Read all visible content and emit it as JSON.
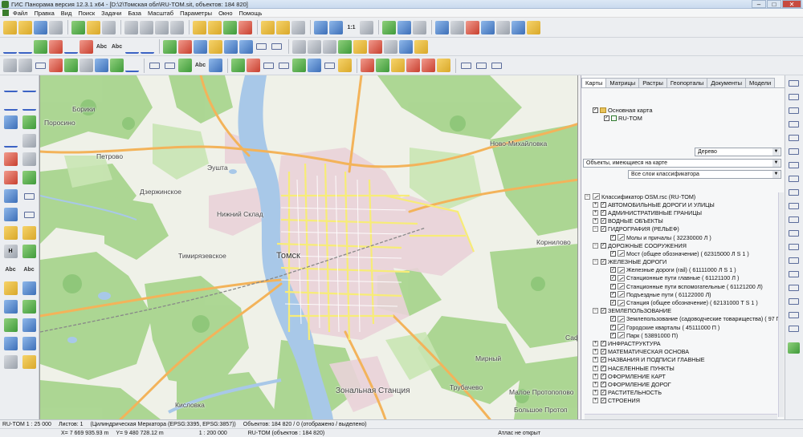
{
  "window": {
    "title": "ГИС Панорама версия 12.3.1 x64 - [D:\\2\\Томская обл\\RU-TOM.sit, объектов: 184 820]"
  },
  "menu": [
    "Файл",
    "Правка",
    "Вид",
    "Поиск",
    "Задачи",
    "База",
    "Масштаб",
    "Параметры",
    "Окно",
    "Помощь"
  ],
  "toolbar": {
    "scale_11": "1:1",
    "text_abc": "Abc"
  },
  "left_tools": {
    "h_label": "H",
    "abc1": "Abc",
    "abc2": "Abc"
  },
  "map": {
    "labels": {
      "boriki": "Борики",
      "porosino": "Поросино",
      "petrovo": "Петрово",
      "eushta": "Эушта",
      "dzerzhinskoe": "Дзержинское",
      "nizhniy_sklad": "Нижний Склад",
      "novo_mikhailovka": "Ново-Михайловка",
      "timiryazevskoe": "Тимирязевское",
      "tomsk": "Томск",
      "kornilovo": "Корнилово",
      "mirny": "Мирный",
      "trubachevo": "Трубачево",
      "zonalnaya": "Зональная Станция",
      "maloe_protopopovo": "Малое Протопопово",
      "bolshoe_protopopovo": "Большое Протоп",
      "kislovka": "Кисловка",
      "saf": "Саф"
    }
  },
  "panel": {
    "tabs": [
      "Карты",
      "Матрицы",
      "Растры",
      "Геопорталы",
      "Документы",
      "Модели"
    ],
    "active_tab": "Карты",
    "map_tree": {
      "root": "Основная карта",
      "child": "RU-TOM"
    },
    "view_mode": "Дерево",
    "objects_filter": "Объекты, имеющиеся на карте",
    "layers_filter": "Все слои классификатора",
    "classifier": "Классификатор OSM.rsc (RU-TOM)",
    "layers": [
      {
        "exp": "+",
        "indent": 0,
        "label": "АВТОМОБИЛЬНЫЕ ДОРОГИ И УЛИЦЫ"
      },
      {
        "exp": "+",
        "indent": 0,
        "label": "АДМИНИСТРАТИВНЫЕ ГРАНИЦЫ"
      },
      {
        "exp": "+",
        "indent": 0,
        "label": "ВОДНЫЕ ОБЪЕКТЫ"
      },
      {
        "exp": "−",
        "indent": 0,
        "label": "ГИДРОГРАФИЯ (РЕЛЬЕФ)"
      },
      {
        "exp": "",
        "indent": 1,
        "label": "Молы и причалы ( 32230000 Л )"
      },
      {
        "exp": "−",
        "indent": 0,
        "label": "ДОРОЖНЫЕ СООРУЖЕНИЯ"
      },
      {
        "exp": "",
        "indent": 1,
        "label": "Мост (общее обозначение) ( 62315000 Л S 1 )"
      },
      {
        "exp": "−",
        "indent": 0,
        "label": "ЖЕЛЕЗНЫЕ ДОРОГИ"
      },
      {
        "exp": "",
        "indent": 1,
        "label": "Железные дороги (rail) ( 61111000 Л S 1 )"
      },
      {
        "exp": "",
        "indent": 1,
        "label": "Станционные пути главные ( 61121100 Л )"
      },
      {
        "exp": "",
        "indent": 1,
        "label": "Станционные пути вспомогательные ( 61121200 Л)"
      },
      {
        "exp": "",
        "indent": 1,
        "label": "Подъездные пути ( 61122000 Л)"
      },
      {
        "exp": "",
        "indent": 1,
        "label": "Станция (общее обозначение) ( 62131000 T S 1 )"
      },
      {
        "exp": "−",
        "indent": 0,
        "label": "ЗЕМЛЕПОЛЬЗОВАНИЕ"
      },
      {
        "exp": "",
        "indent": 1,
        "label": "Землепользование (садоводческие товарищества) ( 97 П S"
      },
      {
        "exp": "",
        "indent": 1,
        "label": "Городские кварталы ( 45111000 П )"
      },
      {
        "exp": "",
        "indent": 1,
        "label": "Парк ( 53891000 П)"
      },
      {
        "exp": "+",
        "indent": 0,
        "label": "ИНФРАСТРУКТУРА"
      },
      {
        "exp": "+",
        "indent": 0,
        "label": "МАТЕМАТИЧЕСКАЯ ОСНОВА"
      },
      {
        "exp": "+",
        "indent": 0,
        "label": "НАЗВАНИЯ И ПОДПИСИ ГЛАВНЫЕ"
      },
      {
        "exp": "+",
        "indent": 0,
        "label": "НАСЕЛЕННЫЕ ПУНКТЫ"
      },
      {
        "exp": "+",
        "indent": 0,
        "label": "ОФОРМЛЕНИЕ КАРТ"
      },
      {
        "exp": "+",
        "indent": 0,
        "label": "ОФОРМЛЕНИЕ ДОРОГ"
      },
      {
        "exp": "+",
        "indent": 0,
        "label": "РАСТИТЕЛЬНОСТЬ"
      },
      {
        "exp": "+",
        "indent": 0,
        "label": "СТРОЕНИЯ"
      }
    ]
  },
  "status": {
    "scale": "RU-TOM 1 : 25 000",
    "sheets": "Листов: 1",
    "projection": "(Цилиндрическая Меркатора (EPSG:3395, EPSG:3857))",
    "objects": "Объектов: 184 820 / 0 (отображено / выделено)",
    "x": "X= 7 669 935.93 m",
    "y": "Y= 9 480 728.12 m",
    "scale2": "1 : 200 000",
    "map_objects": "RU-TOM (объектов : 184 820)",
    "atlas": "Атлас не открыт"
  }
}
